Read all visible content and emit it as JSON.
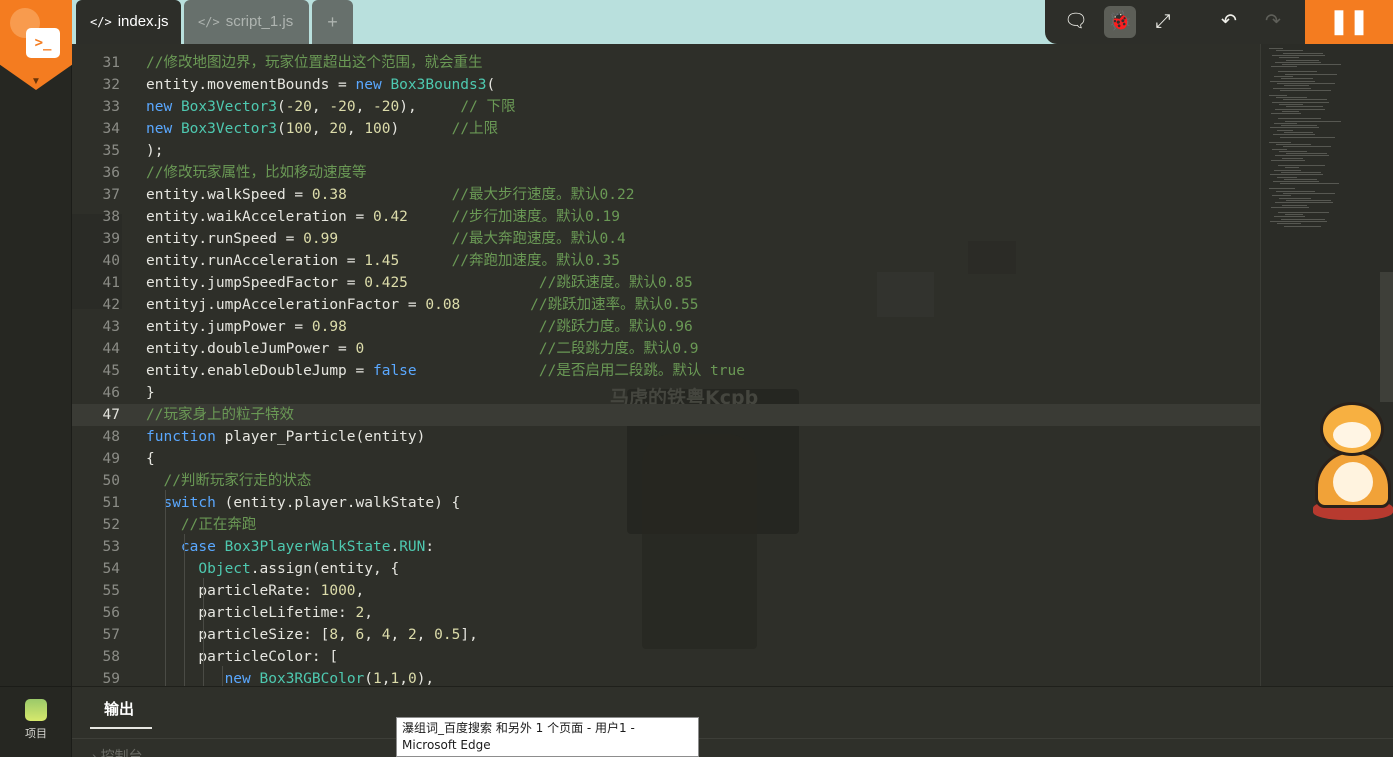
{
  "tabs": [
    {
      "icon": "</>",
      "label": "index.js",
      "active": true
    },
    {
      "icon": "</>",
      "label": "script_1.js",
      "active": false
    },
    {
      "icon": "",
      "label": "+",
      "active": false
    }
  ],
  "toolbar": {
    "buttons": [
      {
        "name": "comment-icon",
        "glyph": "🗨",
        "selected": false
      },
      {
        "name": "debug-bug-icon",
        "glyph": "🐞",
        "selected": true
      },
      {
        "name": "expand-icon",
        "glyph": "⤢",
        "selected": false
      },
      {
        "name": "undo-icon",
        "glyph": "↶",
        "selected": false
      },
      {
        "name": "redo-icon",
        "glyph": "↷",
        "selected": false
      }
    ],
    "pause_glyph": "❚❚"
  },
  "sidebar": {
    "logo_glyph": ">_",
    "project_label": "项目"
  },
  "editor": {
    "current_line": 47,
    "lines": [
      {
        "n": "31",
        "code": "//修改地图边界，玩家位置超出这个范围，就会重生"
      },
      {
        "n": "32",
        "code": "entity.movementBounds = new Box3Bounds3("
      },
      {
        "n": "33",
        "code": "new Box3Vector3(-20, -20, -20),     // 下限"
      },
      {
        "n": "34",
        "code": "new Box3Vector3(100, 20, 100)      //上限"
      },
      {
        "n": "35",
        "code": ");"
      },
      {
        "n": "36",
        "code": "//修改玩家属性，比如移动速度等"
      },
      {
        "n": "37",
        "code": "entity.walkSpeed = 0.38            //最大步行速度。默认0.22"
      },
      {
        "n": "38",
        "code": "entity.waikAcceleration = 0.42     //步行加速度。默认0.19"
      },
      {
        "n": "39",
        "code": "entity.runSpeed = 0.99             //最大奔跑速度。默认0.4"
      },
      {
        "n": "40",
        "code": "entity.runAcceleration = 1.45      //奔跑加速度。默认0.35"
      },
      {
        "n": "41",
        "code": "entity.jumpSpeedFactor = 0.425               //跳跃速度。默认0.85"
      },
      {
        "n": "42",
        "code": "entityj.umpAccelerationFactor = 0.08        //跳跃加速率。默认0.55"
      },
      {
        "n": "43",
        "code": "entity.jumpPower = 0.98                      //跳跃力度。默认0.96"
      },
      {
        "n": "44",
        "code": "entity.doubleJumPower = 0                    //二段跳力度。默认0.9"
      },
      {
        "n": "45",
        "code": "entity.enableDoubleJump = false              //是否启用二段跳。默认 true"
      },
      {
        "n": "46",
        "code": "}"
      },
      {
        "n": "47",
        "code": "//玩家身上的粒子特效"
      },
      {
        "n": "48",
        "code": "function player_Particle(entity)"
      },
      {
        "n": "49",
        "code": "{"
      },
      {
        "n": "50",
        "code": "  //判断玩家行走的状态"
      },
      {
        "n": "51",
        "code": "  switch (entity.player.walkState) {"
      },
      {
        "n": "52",
        "code": "    //正在奔跑"
      },
      {
        "n": "53",
        "code": "    case Box3PlayerWalkState.RUN:"
      },
      {
        "n": "54",
        "code": "      Object.assign(entity, {"
      },
      {
        "n": "55",
        "code": "      particleRate: 1000,"
      },
      {
        "n": "56",
        "code": "      particleLifetime: 2,"
      },
      {
        "n": "57",
        "code": "      particleSize: [8, 6, 4, 2, 0.5],"
      },
      {
        "n": "58",
        "code": "      particleColor: ["
      },
      {
        "n": "59",
        "code": "         new Box3RGBColor(1,1,0),"
      }
    ]
  },
  "watermark": "马虎的铁粤Kcpb",
  "bottom_panel": {
    "output_tab": "输出",
    "console_label": "控制台"
  },
  "tooltip": "瀑组词_百度搜索 和另外 1 个页面 - 用户1 - Microsoft Edge",
  "colors": {
    "accent": "#f47c20",
    "tab_bar": "#b9e0dd",
    "editor_bg": "#2e2f29",
    "keyword": "#5aa8ff",
    "type": "#4ec9b0",
    "comment": "#6a9955",
    "number": "#dcdcaa"
  }
}
